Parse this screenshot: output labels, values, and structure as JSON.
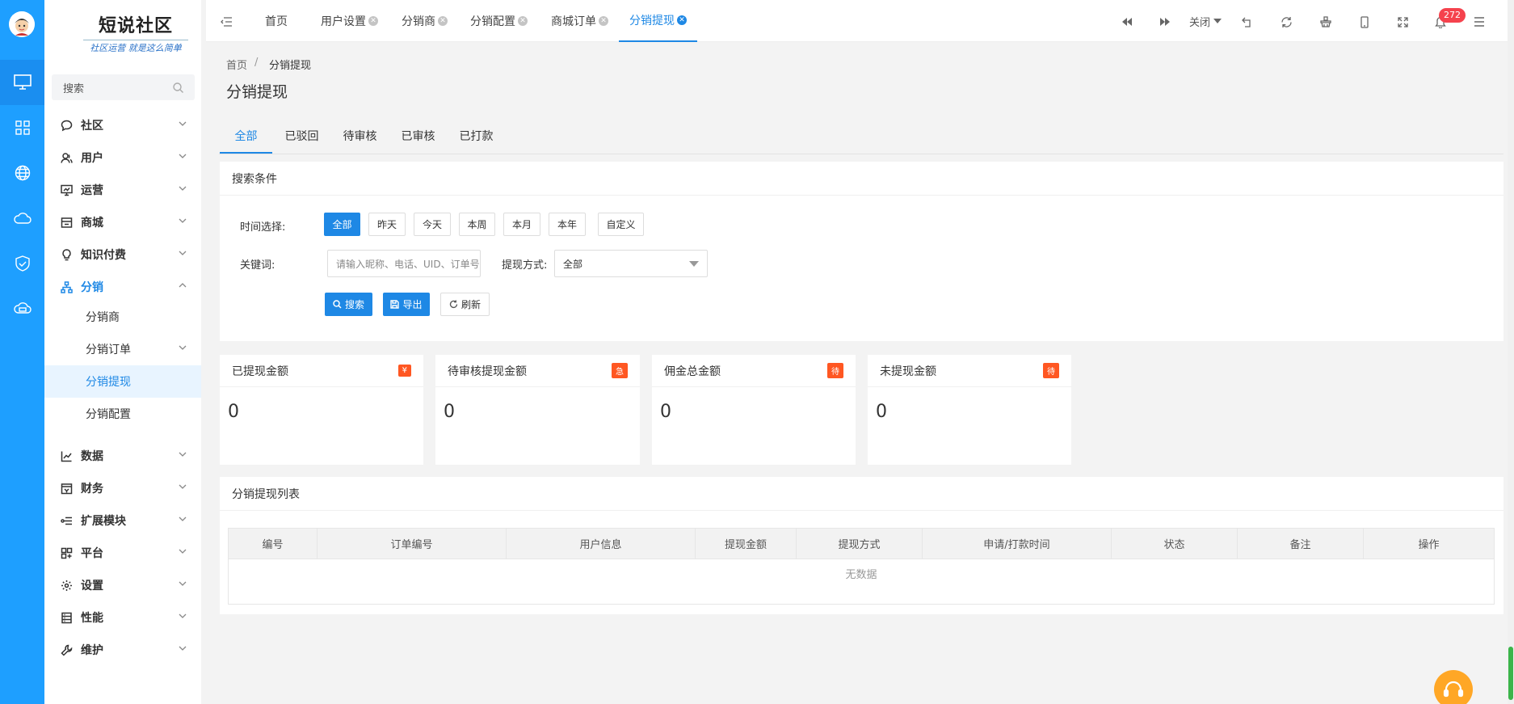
{
  "sidebar": {
    "logo_title": "短说社区",
    "logo_slogan": "社区运营 就是这么简单",
    "search_placeholder": "搜索",
    "menu": [
      {
        "label": "社区",
        "icon": "chat-icon"
      },
      {
        "label": "用户",
        "icon": "user-icon"
      },
      {
        "label": "运营",
        "icon": "monitor-chart-icon"
      },
      {
        "label": "商城",
        "icon": "store-icon"
      },
      {
        "label": "知识付费",
        "icon": "bulb-icon"
      },
      {
        "label": "分销",
        "icon": "hierarchy-icon"
      },
      {
        "label": "数据",
        "icon": "line-chart-icon"
      },
      {
        "label": "财务",
        "icon": "finance-icon"
      },
      {
        "label": "扩展模块",
        "icon": "extend-icon"
      },
      {
        "label": "平台",
        "icon": "platform-icon"
      },
      {
        "label": "设置",
        "icon": "gear-icon"
      },
      {
        "label": "性能",
        "icon": "server-icon"
      },
      {
        "label": "维护",
        "icon": "wrench-icon"
      }
    ],
    "submenu": [
      "分销商",
      "分销订单",
      "分销提现",
      "分销配置"
    ]
  },
  "topbar": {
    "tabs": [
      "首页",
      "用户设置",
      "分销商",
      "分销配置",
      "商城订单",
      "分销提现"
    ],
    "close_label": "关闭",
    "notification_count": "272"
  },
  "breadcrumb": {
    "home": "首页",
    "separator": "/",
    "current": "分销提现"
  },
  "page_title": "分销提现",
  "status_tabs": [
    "全部",
    "已驳回",
    "待审核",
    "已审核",
    "已打款"
  ],
  "search_panel": {
    "title": "搜索条件",
    "time_label": "时间选择:",
    "time_options": [
      "全部",
      "昨天",
      "今天",
      "本周",
      "本月",
      "本年",
      "自定义"
    ],
    "keyword_label": "关键词:",
    "keyword_placeholder": "请输入昵称、电话、UID、订单号",
    "method_label": "提现方式:",
    "method_value": "全部",
    "search_btn": "搜索",
    "export_btn": "导出",
    "refresh_btn": "刷新"
  },
  "stats": [
    {
      "title": "已提现金额",
      "badge": "¥",
      "value": "0"
    },
    {
      "title": "待审核提现金额",
      "badge": "急",
      "value": "0"
    },
    {
      "title": "佣金总金额",
      "badge": "待",
      "value": "0"
    },
    {
      "title": "未提现金额",
      "badge": "待",
      "value": "0"
    }
  ],
  "list": {
    "title": "分销提现列表",
    "columns": [
      "编号",
      "订单编号",
      "用户信息",
      "提现金额",
      "提现方式",
      "申请/打款时间",
      "状态",
      "备注",
      "操作"
    ],
    "empty_text": "无数据"
  },
  "colors": {
    "primary": "#1e88e5",
    "rail": "#1e9fff",
    "badge": "#ff5722",
    "notify": "#f5424d",
    "support": "#ffa726"
  }
}
